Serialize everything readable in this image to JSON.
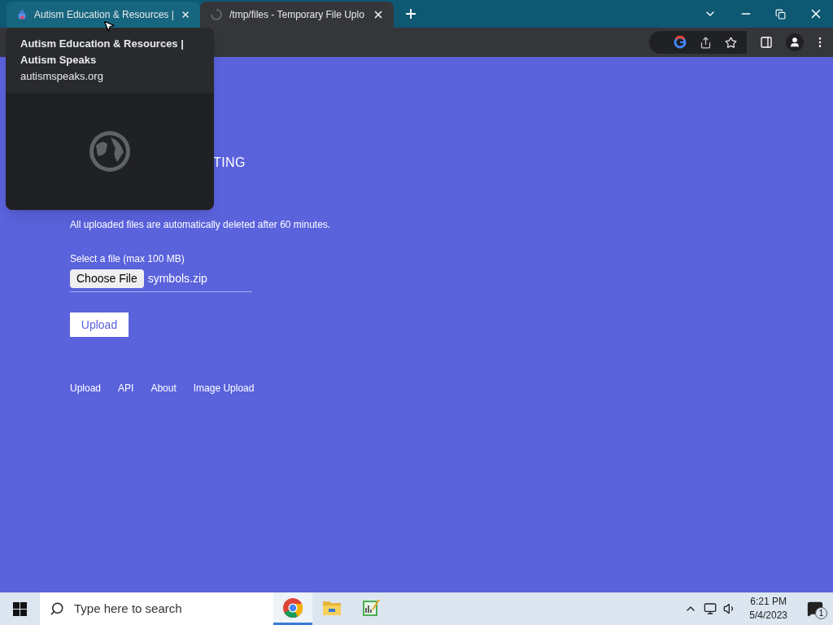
{
  "tabs": [
    {
      "title": "Autism Education & Resources |",
      "selected": false
    },
    {
      "title": "/tmp/files - Temporary File Uplo",
      "selected": true
    }
  ],
  "hover_card": {
    "title": "Autism Education & Resources | Autism Speaks",
    "url": "autismspeaks.org"
  },
  "page": {
    "heading": "TING",
    "notice": "All uploaded files are automatically deleted after 60 minutes.",
    "file_label": "Select a file (max 100 MB)",
    "choose_button": "Choose File",
    "file_name": "symbols.zip",
    "upload_button": "Upload",
    "footer_links": [
      "Upload",
      "API",
      "About",
      "Image Upload"
    ]
  },
  "taskbar": {
    "search_placeholder": "Type here to search",
    "apps": [
      {
        "selected": true
      },
      {
        "selected": false
      },
      {
        "selected": false
      }
    ],
    "time": "6:21 PM",
    "date": "5/4/2023",
    "notifications": "1"
  }
}
